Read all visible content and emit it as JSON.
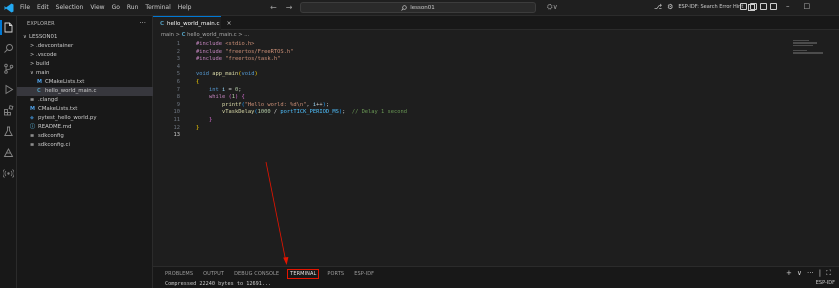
{
  "titlebar": {
    "menu": [
      "File",
      "Edit",
      "Selection",
      "View",
      "Go",
      "Run",
      "Terminal",
      "Help"
    ],
    "nav_back": "←",
    "nav_forward": "→",
    "search_text": "lesson01",
    "right_status": "ESP-IDF: Search Error Hint",
    "win_min": "–",
    "win_max": "□",
    "win_close": "✕"
  },
  "sidebar": {
    "title": "EXPLORER",
    "more": "···",
    "items": [
      {
        "chevron": "∨",
        "label": "LESSON01",
        "indent": 0,
        "icon": "",
        "icon_color": "#cccccc"
      },
      {
        "chevron": ">",
        "label": ".devcontainer",
        "indent": 1,
        "icon": "",
        "icon_color": "#cccccc"
      },
      {
        "chevron": ">",
        "label": ".vscode",
        "indent": 1,
        "icon": "",
        "icon_color": "#cccccc"
      },
      {
        "chevron": ">",
        "label": "build",
        "indent": 1,
        "icon": "",
        "icon_color": "#cccccc"
      },
      {
        "chevron": "∨",
        "label": "main",
        "indent": 1,
        "icon": "",
        "icon_color": "#cccccc"
      },
      {
        "chevron": "",
        "label": "CMakeLists.txt",
        "indent": 2,
        "icon": "M",
        "icon_color": "#4fa1e8"
      },
      {
        "chevron": "",
        "label": "hello_world_main.c",
        "indent": 2,
        "icon": "C",
        "icon_color": "#519aba"
      },
      {
        "chevron": "",
        "label": ".clangd",
        "indent": 1,
        "icon": "≡",
        "icon_color": "#cccccc"
      },
      {
        "chevron": "",
        "label": "CMakeLists.txt",
        "indent": 1,
        "icon": "M",
        "icon_color": "#4fa1e8"
      },
      {
        "chevron": "",
        "label": "pytest_hello_world.py",
        "indent": 1,
        "icon": "◆",
        "icon_color": "#3572a5"
      },
      {
        "chevron": "",
        "label": "README.md",
        "indent": 1,
        "icon": "ⓘ",
        "icon_color": "#519aba"
      },
      {
        "chevron": "",
        "label": "sdkconfig",
        "indent": 1,
        "icon": "≡",
        "icon_color": "#cccccc"
      },
      {
        "chevron": "",
        "label": "sdkconfig.ci",
        "indent": 1,
        "icon": "≡",
        "icon_color": "#cccccc"
      }
    ],
    "selected_index": 6
  },
  "editor": {
    "tab_icon": "C",
    "tab_label": "hello_world_main.c",
    "tab_close": "×",
    "breadcrumb_folder": "main",
    "breadcrumb_sep": ">",
    "breadcrumb_icon": "C",
    "breadcrumb_file": "hello_world_main.c",
    "breadcrumb_tail": "> ...",
    "current_line": 13,
    "lines": [
      [
        {
          "t": "#include ",
          "c": "kwc"
        },
        {
          "t": "<stdio.h>",
          "c": "str"
        }
      ],
      [
        {
          "t": "#include ",
          "c": "kwc"
        },
        {
          "t": "\"freertos/FreeRTOS.h\"",
          "c": "str"
        }
      ],
      [
        {
          "t": "#include ",
          "c": "kwc"
        },
        {
          "t": "\"freertos/task.h\"",
          "c": "str"
        }
      ],
      [],
      [
        {
          "t": "void ",
          "c": "kw"
        },
        {
          "t": "app_main",
          "c": "fn"
        },
        {
          "t": "(",
          "c": "brk"
        },
        {
          "t": "void",
          "c": "kw"
        },
        {
          "t": ")",
          "c": "brk"
        }
      ],
      [
        {
          "t": "{",
          "c": "brk"
        }
      ],
      [
        {
          "t": "    int ",
          "c": "kw"
        },
        {
          "t": "i",
          "c": "var"
        },
        {
          "t": " = ",
          "c": "op"
        },
        {
          "t": "0",
          "c": "num"
        },
        {
          "t": ";",
          "c": "op"
        }
      ],
      [
        {
          "t": "    while ",
          "c": "kwc"
        },
        {
          "t": "(",
          "c": "brk2"
        },
        {
          "t": "1",
          "c": "num"
        },
        {
          "t": ") ",
          "c": "brk2"
        },
        {
          "t": "{",
          "c": "brk2"
        }
      ],
      [
        {
          "t": "        printf",
          "c": "fn"
        },
        {
          "t": "(",
          "c": "brk3"
        },
        {
          "t": "\"Hello world: %d\\n\"",
          "c": "str"
        },
        {
          "t": ", ",
          "c": "op"
        },
        {
          "t": "i",
          "c": "var"
        },
        {
          "t": "++",
          "c": "op"
        },
        {
          "t": ")",
          "c": "brk3"
        },
        {
          "t": ";",
          "c": "op"
        }
      ],
      [
        {
          "t": "        vTaskDelay",
          "c": "fn"
        },
        {
          "t": "(",
          "c": "brk3"
        },
        {
          "t": "1000",
          "c": "num"
        },
        {
          "t": " / ",
          "c": "op"
        },
        {
          "t": "portTICK_PERIOD_MS",
          "c": "mac"
        },
        {
          "t": ")",
          "c": "brk3"
        },
        {
          "t": ";  ",
          "c": "op"
        },
        {
          "t": "// Delay 1 second",
          "c": "cmt"
        }
      ],
      [
        {
          "t": "    }",
          "c": "brk2"
        }
      ],
      [
        {
          "t": "}",
          "c": "brk"
        }
      ],
      []
    ]
  },
  "panel": {
    "tabs": [
      "PROBLEMS",
      "OUTPUT",
      "DEBUG CONSOLE",
      "TERMINAL",
      "PORTS",
      "ESP-IDF"
    ],
    "active_tab": "TERMINAL",
    "output_line": "Compressed 22240 bytes to 12691...",
    "actions": [
      "+",
      "∨",
      "···",
      "|",
      "⛶"
    ],
    "right_label": "ESP-IDF"
  },
  "colors": {
    "accent": "#0078d4",
    "annotation": "#e51400"
  },
  "icons": [
    "vscode-logo-icon",
    "files-icon",
    "search-icon",
    "source-control-icon",
    "run-debug-icon",
    "extensions-icon",
    "testing-icon",
    "esp-idf-icon",
    "broadcast-icon"
  ]
}
